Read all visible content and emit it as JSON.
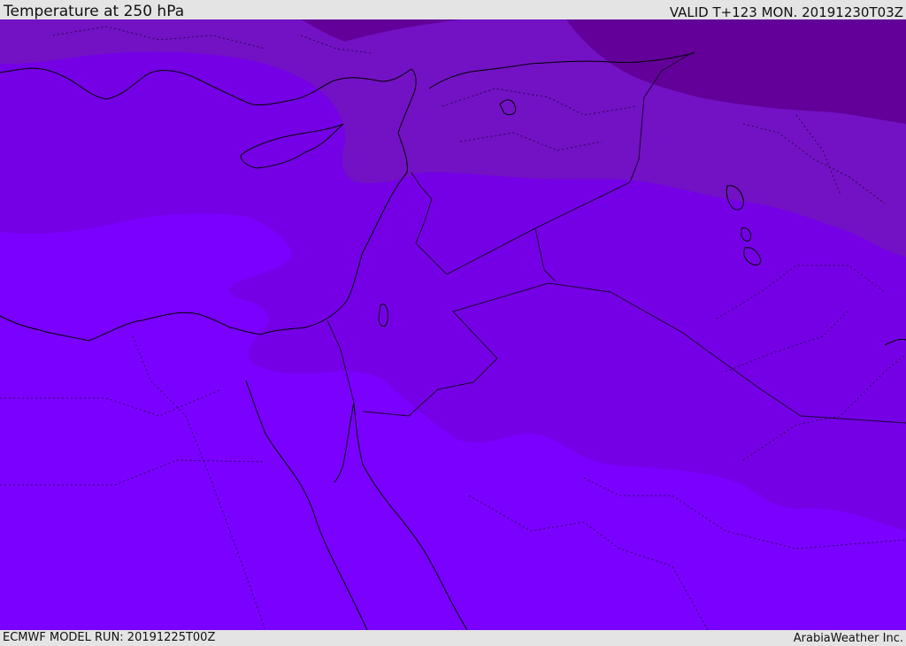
{
  "header": {
    "title": "Temperature at 250 hPa",
    "valid": "VALID T+123 MON. 20191230T03Z"
  },
  "footer": {
    "model_run": "ECMWF MODEL RUN: 20191225T00Z",
    "credit": "ArabiaWeather Inc."
  },
  "map": {
    "colors": {
      "band_warmest": "#7a00ff",
      "band_mid": "#7500e6",
      "band_cool": "#7212c4",
      "band_coldest": "#620099",
      "coastline": "#000000",
      "border": "#1a0033"
    }
  }
}
